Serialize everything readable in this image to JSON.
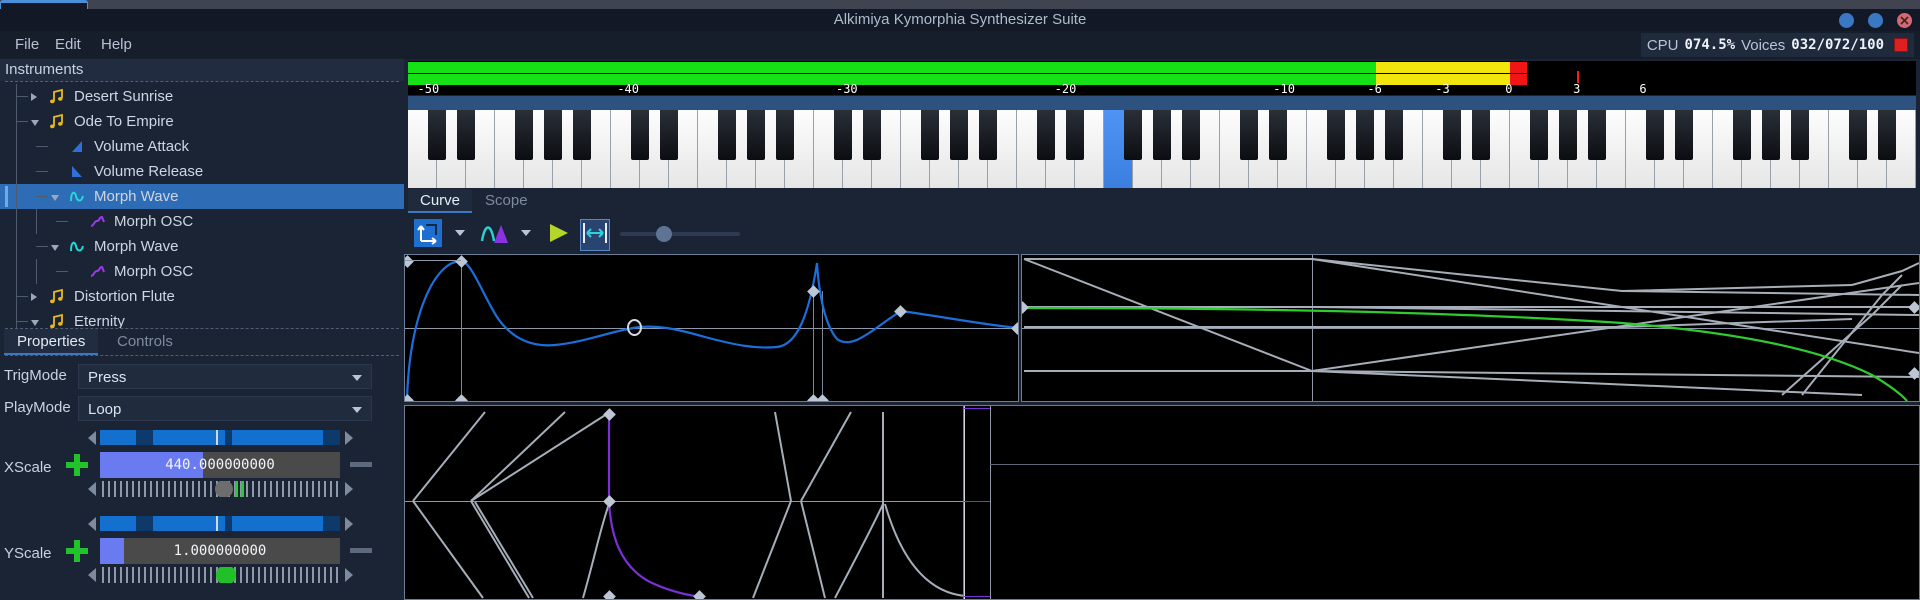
{
  "window": {
    "title": "Alkimiya Kymorphia Synthesizer Suite",
    "buttons": {
      "minimize": "minimize",
      "maximize": "maximize",
      "close": "close"
    }
  },
  "menubar": {
    "items": [
      {
        "label": "File",
        "x": 8
      },
      {
        "label": "Edit",
        "x": 48
      },
      {
        "label": "Help",
        "x": 94
      }
    ]
  },
  "status": {
    "cpu_label": "CPU",
    "cpu_value": "074.5%",
    "voices_label": "Voices",
    "voices_value": "032/072/100",
    "indicator_color": "#e02020"
  },
  "sidebar": {
    "header": "Instruments",
    "tree": [
      {
        "label": "Desert Sunrise",
        "depth": 1,
        "twisty": "closed",
        "icon": "music-note-icon",
        "selected": false
      },
      {
        "label": "Ode To Empire",
        "depth": 1,
        "twisty": "open",
        "icon": "music-note-icon",
        "selected": false
      },
      {
        "label": "Volume Attack",
        "depth": 2,
        "twisty": "none",
        "icon": "attack-ramp-icon",
        "selected": false
      },
      {
        "label": "Volume Release",
        "depth": 2,
        "twisty": "none",
        "icon": "release-ramp-icon",
        "selected": false
      },
      {
        "label": "Morph Wave",
        "depth": 2,
        "twisty": "open",
        "icon": "sine-wave-icon",
        "selected": true
      },
      {
        "label": "Morph OSC",
        "depth": 3,
        "twisty": "none",
        "icon": "osc-wave-icon",
        "selected": false
      },
      {
        "label": "Morph Wave",
        "depth": 2,
        "twisty": "open",
        "icon": "sine-wave-icon",
        "selected": false
      },
      {
        "label": "Morph OSC",
        "depth": 3,
        "twisty": "none",
        "icon": "osc-wave-icon",
        "selected": false
      },
      {
        "label": "Distortion Flute",
        "depth": 1,
        "twisty": "closed",
        "icon": "music-note-icon",
        "selected": false
      },
      {
        "label": "Eternity",
        "depth": 1,
        "twisty": "open",
        "icon": "music-note-icon",
        "selected": false
      }
    ],
    "tabs": [
      {
        "label": "Properties",
        "active": true
      },
      {
        "label": "Controls",
        "active": false
      }
    ],
    "properties": {
      "trigmode": {
        "label": "TrigMode",
        "value": "Press"
      },
      "playmode": {
        "label": "PlayMode",
        "value": "Loop"
      },
      "xscale": {
        "label": "XScale",
        "value": "440.000000000",
        "fill_pct": 43,
        "knob_pct": 52,
        "green_mark_pct": 58,
        "plus_label": "add",
        "minus_label": "subtract"
      },
      "yscale": {
        "label": "YScale",
        "value": "1.000000000",
        "fill_pct": 10,
        "knob_pct": 52,
        "plus_label": "add",
        "minus_label": "subtract"
      }
    }
  },
  "meter": {
    "ticks": [
      {
        "label": "-50",
        "pct": 0.5
      },
      {
        "label": "-40",
        "pct": 14.6
      },
      {
        "label": "-30",
        "pct": 29.1
      },
      {
        "label": "-20",
        "pct": 43.6
      },
      {
        "label": "-10",
        "pct": 58.1
      },
      {
        "label": "-6",
        "pct": 64.1
      },
      {
        "label": "-3",
        "pct": 68.6
      },
      {
        "label": "0",
        "pct": 73.0
      },
      {
        "label": "3",
        "pct": 77.5
      },
      {
        "label": "6",
        "pct": 81.9
      }
    ],
    "red_tick_pct": 77.5,
    "green_end_pct": 64.2,
    "yellow_end_pct": 73.1,
    "red_end_pct": 74.2,
    "colors": {
      "green": "#16e016",
      "yellow": "#f2e50d",
      "red": "#f21515"
    }
  },
  "keyboard": {
    "active_key_index": 24,
    "white_key_count": 52
  },
  "curve_panel": {
    "tabs": [
      {
        "label": "Curve",
        "active": true
      },
      {
        "label": "Scope",
        "active": false
      }
    ],
    "toolbar": {
      "tool_mode": "move-points-icon",
      "tool_mode_dropdown": "chevron-down-icon",
      "curve_shape": "curve-shape-icon",
      "curve_shape_dropdown": "chevron-down-icon",
      "play": "play-icon",
      "fit_width": "fit-width-icon",
      "zoom_slider_pct": 30
    }
  },
  "chart_data": [
    {
      "type": "line",
      "name": "envelope-curve-top-left",
      "xlim": [
        0,
        1
      ],
      "ylim": [
        0,
        1
      ],
      "grid": false,
      "series": [
        {
          "name": "envelope",
          "color": "#1b6fdb",
          "points": [
            [
              0.003,
              0.0
            ],
            [
              0.093,
              0.965
            ],
            [
              0.327,
              0.64
            ],
            [
              0.5,
              0.385
            ],
            [
              0.655,
              0.5
            ],
            [
              0.762,
              0.52
            ],
            [
              0.855,
              0.625
            ]
          ]
        }
      ],
      "control_points": [
        [
          0.003,
          0.965
        ],
        [
          0.093,
          0.965
        ],
        [
          0.003,
          0.0
        ],
        [
          0.093,
          0.0
        ],
        [
          0.327,
          0.64
        ],
        [
          0.655,
          0.5
        ],
        [
          0.762,
          0.52
        ],
        [
          0.855,
          0.625
        ],
        [
          1.0,
          0.5
        ]
      ],
      "selected_point": [
        0.327,
        0.64
      ],
      "midline_y": 0.5
    },
    {
      "type": "line",
      "name": "wave-overlay-top-right",
      "xlim": [
        0,
        1
      ],
      "ylim": [
        0,
        1
      ],
      "grid": false,
      "series": [
        {
          "name": "morph-output",
          "color": "#2ecc2e"
        }
      ],
      "overlay_line_color": "#a6aeba",
      "midline_y": 0.5
    },
    {
      "type": "line",
      "name": "wave-overlay-bottom-left",
      "xlim": [
        0,
        1
      ],
      "ylim": [
        0,
        1
      ],
      "grid": false,
      "series": [
        {
          "name": "morph-osc",
          "color": "#7b2fd6"
        }
      ],
      "overlay_line_color": "#a6aeba",
      "midline_y": 0.5
    },
    {
      "type": "line",
      "name": "wave-overlay-bottom-right",
      "xlim": [
        0,
        1
      ],
      "ylim": [
        0,
        1
      ],
      "grid": false,
      "series": [
        {
          "name": "empty",
          "color": "#7b2fd6"
        }
      ]
    }
  ]
}
